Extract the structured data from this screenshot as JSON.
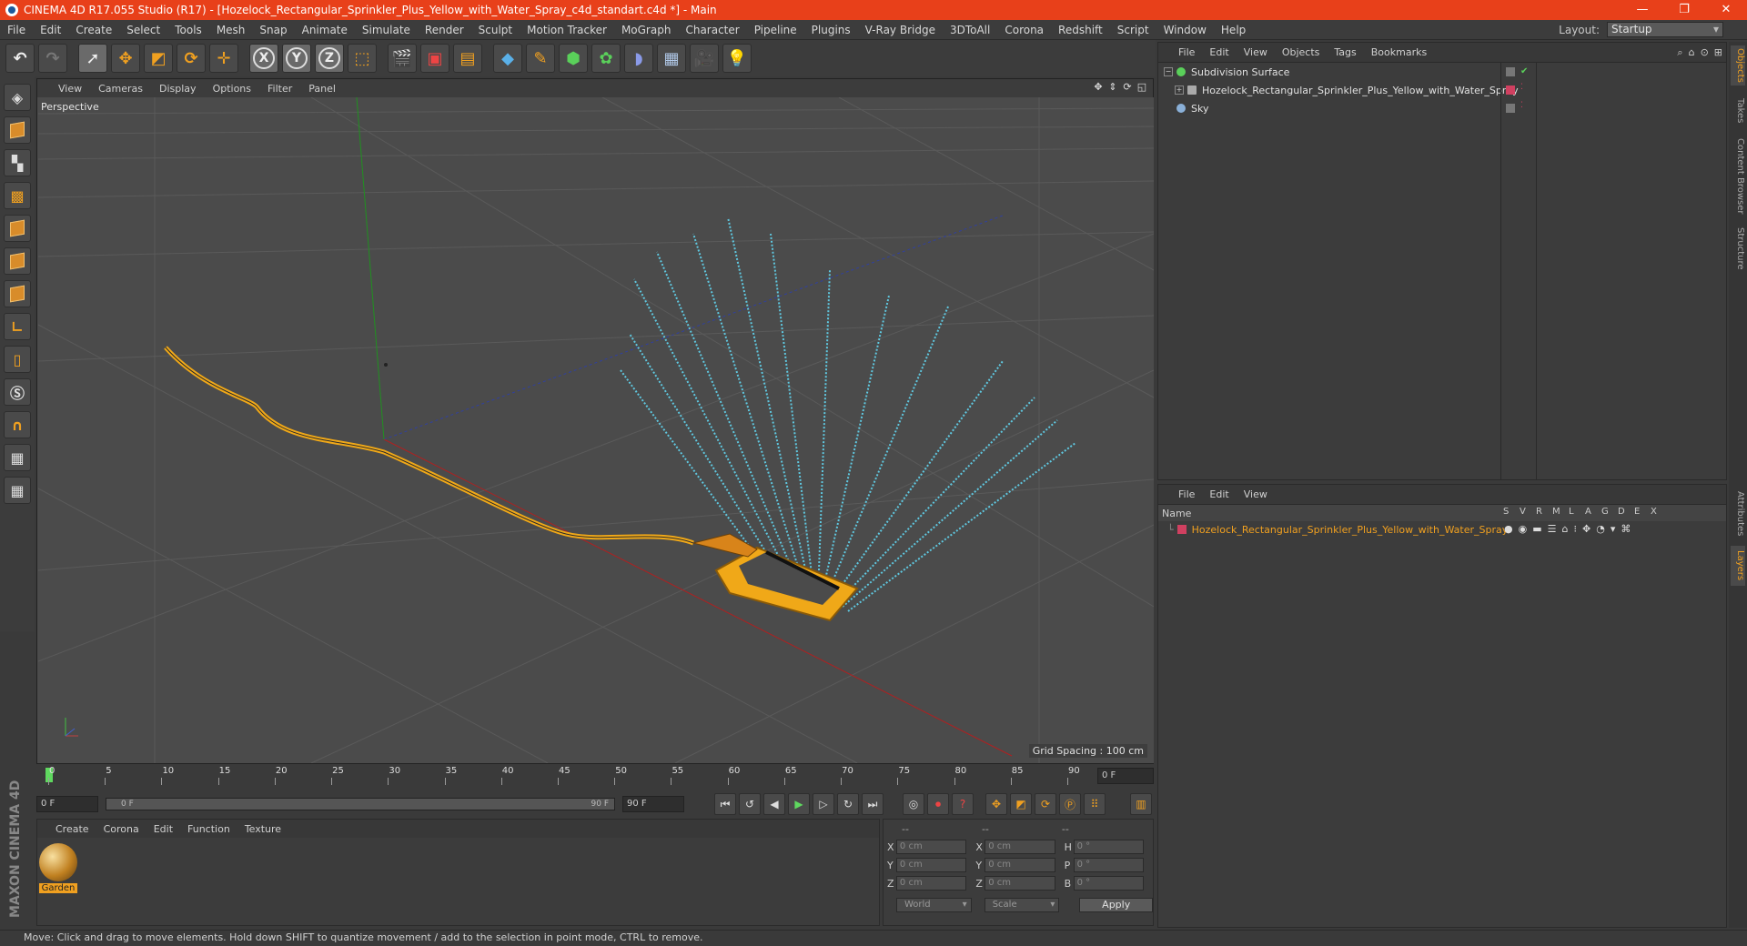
{
  "window": {
    "title": "CINEMA 4D R17.055 Studio (R17) - [Hozelock_Rectangular_Sprinkler_Plus_Yellow_with_Water_Spray_c4d_standart.c4d *] - Main",
    "minimize": "—",
    "maximize": "❐",
    "close": "✕"
  },
  "menu": [
    "File",
    "Edit",
    "Create",
    "Select",
    "Tools",
    "Mesh",
    "Snap",
    "Animate",
    "Simulate",
    "Render",
    "Sculpt",
    "Motion Tracker",
    "MoGraph",
    "Character",
    "Pipeline",
    "Plugins",
    "V-Ray Bridge",
    "3DToAll",
    "Corona",
    "Redshift",
    "Script",
    "Window",
    "Help"
  ],
  "layout": {
    "label": "Layout:",
    "value": "Startup"
  },
  "viewport": {
    "menu": [
      "View",
      "Cameras",
      "Display",
      "Options",
      "Filter",
      "Panel"
    ],
    "label": "Perspective",
    "grid_spacing": "Grid Spacing : 100 cm"
  },
  "timeline": {
    "ticks": [
      "0",
      "5",
      "10",
      "15",
      "20",
      "25",
      "30",
      "35",
      "40",
      "45",
      "50",
      "55",
      "60",
      "65",
      "70",
      "75",
      "80",
      "85",
      "90"
    ],
    "current_frame": "0 F",
    "start": "0 F",
    "slider_start": "0 F",
    "slider_end": "90 F",
    "end": "90 F"
  },
  "materials": {
    "menu": [
      "Create",
      "Corona",
      "Edit",
      "Function",
      "Texture"
    ],
    "items": [
      {
        "name": "Garden"
      }
    ]
  },
  "coordinates": {
    "headers": [
      "--",
      "--",
      "--"
    ],
    "rows": [
      {
        "a": "X",
        "av": "0 cm",
        "b": "X",
        "bv": "0 cm",
        "c": "H",
        "cv": "0 °"
      },
      {
        "a": "Y",
        "av": "0 cm",
        "b": "Y",
        "bv": "0 cm",
        "c": "P",
        "cv": "0 °"
      },
      {
        "a": "Z",
        "av": "0 cm",
        "b": "Z",
        "bv": "0 cm",
        "c": "B",
        "cv": "0 °"
      }
    ],
    "mode": "World",
    "type": "Scale",
    "apply": "Apply"
  },
  "objects": {
    "menu": [
      "File",
      "Edit",
      "View",
      "Objects",
      "Tags",
      "Bookmarks"
    ],
    "items": [
      {
        "name": "Subdivision Surface"
      },
      {
        "name": "Hozelock_Rectangular_Sprinkler_Plus_Yellow_with_Water_Spray"
      },
      {
        "name": "Sky"
      }
    ]
  },
  "layers": {
    "menu": [
      "File",
      "Edit",
      "View"
    ],
    "header_name": "Name",
    "columns": [
      "S",
      "V",
      "R",
      "M",
      "L",
      "A",
      "G",
      "D",
      "E",
      "X"
    ],
    "items": [
      {
        "name": "Hozelock_Rectangular_Sprinkler_Plus_Yellow_with_Water_Spray"
      }
    ]
  },
  "side_tabs": [
    "Objects",
    "Takes",
    "Content Browser",
    "Structure",
    "Attributes",
    "Layers"
  ],
  "status": "Move: Click and drag to move elements. Hold down SHIFT to quantize movement / add to the selection in point mode, CTRL to remove.",
  "branding": "MAXON CINEMA 4D",
  "colors": {
    "titlebar": "#e8401a",
    "accent": "#f0a020",
    "water": "#5fc8e0",
    "hose": "#f0a818",
    "axis_x": "#c02020",
    "axis_y": "#20a020",
    "axis_z": "#2040c0"
  }
}
